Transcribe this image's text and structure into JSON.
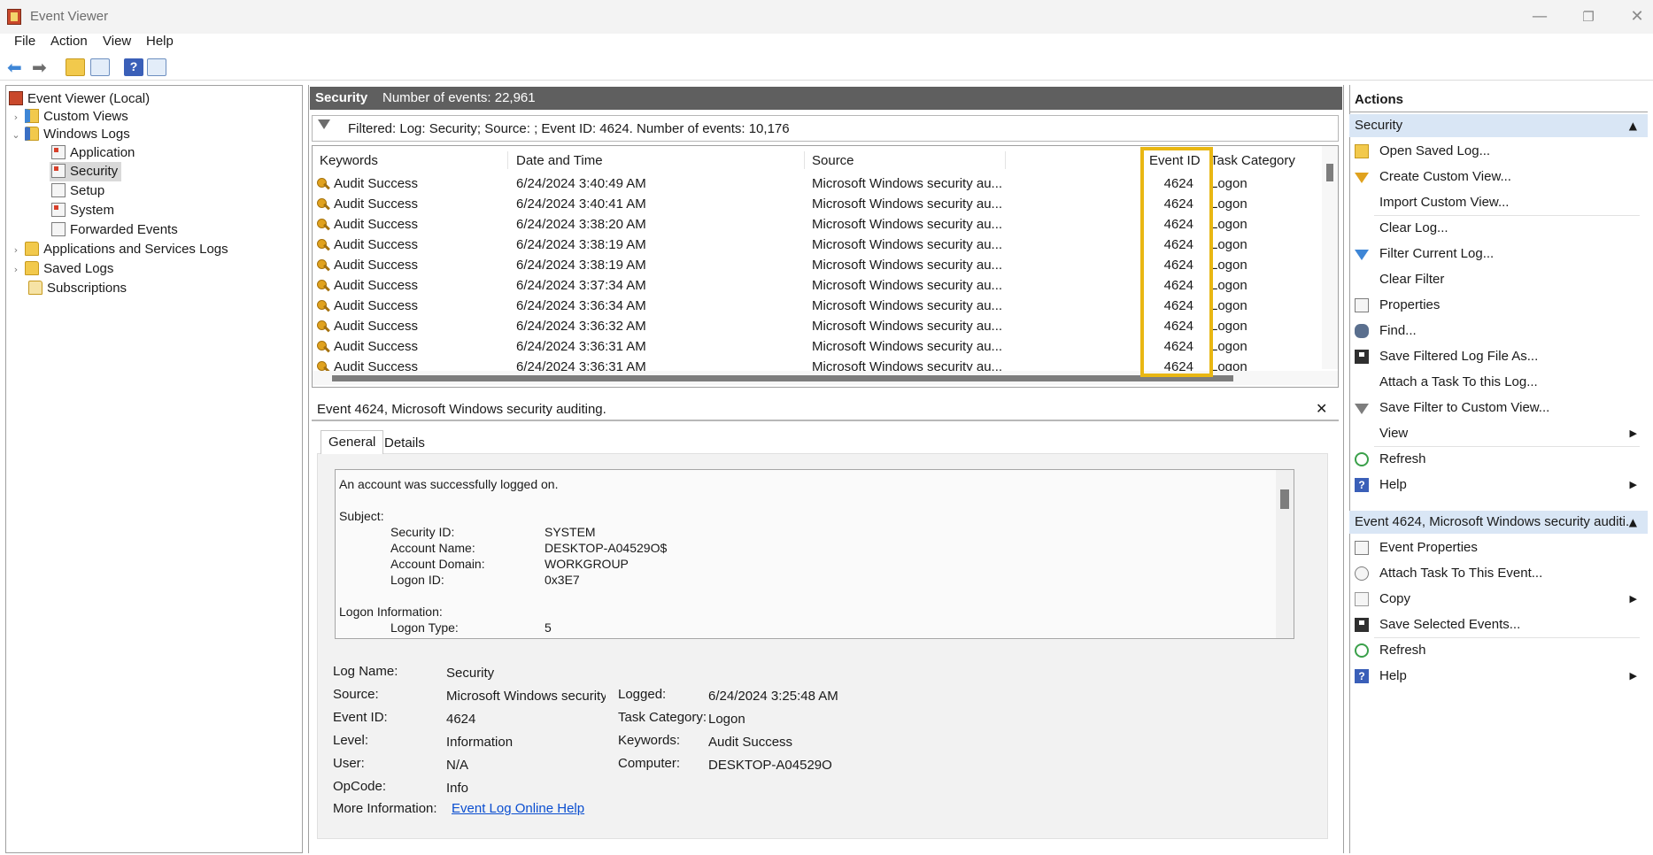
{
  "window": {
    "title": "Event Viewer",
    "minimize": "—",
    "restore": "❐",
    "close": "✕"
  },
  "menu": [
    "File",
    "Action",
    "View",
    "Help"
  ],
  "nav": {
    "root": "Event Viewer (Local)",
    "custom_views": "Custom Views",
    "windows_logs": "Windows Logs",
    "application": "Application",
    "security": "Security",
    "setup": "Setup",
    "system": "System",
    "forwarded": "Forwarded Events",
    "apps_services": "Applications and Services Logs",
    "saved_logs": "Saved Logs",
    "subscriptions": "Subscriptions"
  },
  "center": {
    "log_name": "Security",
    "event_count": "Number of events: 22,961",
    "filter_text": "Filtered: Log: Security; Source: ; Event ID: 4624. Number of events: 10,176",
    "columns": [
      "Keywords",
      "Date and Time",
      "Source",
      "Event ID",
      "Task Category"
    ],
    "rows": [
      {
        "keywords": "Audit Success",
        "date": "6/24/2024 3:40:49 AM",
        "source": "Microsoft Windows security au...",
        "event_id": "4624",
        "task": "Logon"
      },
      {
        "keywords": "Audit Success",
        "date": "6/24/2024 3:40:41 AM",
        "source": "Microsoft Windows security au...",
        "event_id": "4624",
        "task": "Logon"
      },
      {
        "keywords": "Audit Success",
        "date": "6/24/2024 3:38:20 AM",
        "source": "Microsoft Windows security au...",
        "event_id": "4624",
        "task": "Logon"
      },
      {
        "keywords": "Audit Success",
        "date": "6/24/2024 3:38:19 AM",
        "source": "Microsoft Windows security au...",
        "event_id": "4624",
        "task": "Logon"
      },
      {
        "keywords": "Audit Success",
        "date": "6/24/2024 3:38:19 AM",
        "source": "Microsoft Windows security au...",
        "event_id": "4624",
        "task": "Logon"
      },
      {
        "keywords": "Audit Success",
        "date": "6/24/2024 3:37:34 AM",
        "source": "Microsoft Windows security au...",
        "event_id": "4624",
        "task": "Logon"
      },
      {
        "keywords": "Audit Success",
        "date": "6/24/2024 3:36:34 AM",
        "source": "Microsoft Windows security au...",
        "event_id": "4624",
        "task": "Logon"
      },
      {
        "keywords": "Audit Success",
        "date": "6/24/2024 3:36:32 AM",
        "source": "Microsoft Windows security au...",
        "event_id": "4624",
        "task": "Logon"
      },
      {
        "keywords": "Audit Success",
        "date": "6/24/2024 3:36:31 AM",
        "source": "Microsoft Windows security au...",
        "event_id": "4624",
        "task": "Logon"
      },
      {
        "keywords": "Audit Success",
        "date": "6/24/2024 3:36:31 AM",
        "source": "Microsoft Windows security au...",
        "event_id": "4624",
        "task": "Logon"
      }
    ]
  },
  "detail": {
    "title": "Event 4624, Microsoft Windows security auditing.",
    "close": "✕",
    "tabs": [
      "General",
      "Details"
    ],
    "message": {
      "line1": "An account was successfully logged on.",
      "subject": "Subject:",
      "security_id_label": "Security ID:",
      "security_id": "SYSTEM",
      "account_name_label": "Account Name:",
      "account_name": "DESKTOP-A04529O$",
      "account_domain_label": "Account Domain:",
      "account_domain": "WORKGROUP",
      "logon_id_label": "Logon ID:",
      "logon_id": "0x3E7",
      "logon_info": "Logon Information:",
      "logon_type_label": "Logon Type:",
      "logon_type": "5"
    },
    "props": {
      "log_name_label": "Log Name:",
      "log_name": "Security",
      "source_label": "Source:",
      "source": "Microsoft Windows security a",
      "logged_label": "Logged:",
      "logged": "6/24/2024 3:25:48 AM",
      "event_id_label": "Event ID:",
      "event_id": "4624",
      "task_label": "Task Category:",
      "task": "Logon",
      "level_label": "Level:",
      "level": "Information",
      "keywords_label": "Keywords:",
      "keywords": "Audit Success",
      "user_label": "User:",
      "user": "N/A",
      "computer_label": "Computer:",
      "computer": "DESKTOP-A04529O",
      "opcode_label": "OpCode:",
      "opcode": "Info",
      "more_label": "More Information:",
      "more_link": "Event Log Online Help"
    }
  },
  "actions": {
    "title": "Actions",
    "section1": "Security",
    "items1": [
      "Open Saved Log...",
      "Create Custom View...",
      "Import Custom View...",
      "Clear Log...",
      "Filter Current Log...",
      "Clear Filter",
      "Properties",
      "Find...",
      "Save Filtered Log File As...",
      "Attach a Task To this Log...",
      "Save Filter to Custom View...",
      "View",
      "Refresh",
      "Help"
    ],
    "section2": "Event 4624, Microsoft Windows security auditi...",
    "items2": [
      "Event Properties",
      "Attach Task To This Event...",
      "Copy",
      "Save Selected Events...",
      "Refresh",
      "Help"
    ],
    "collapse": "▲",
    "submenu": "▶"
  }
}
